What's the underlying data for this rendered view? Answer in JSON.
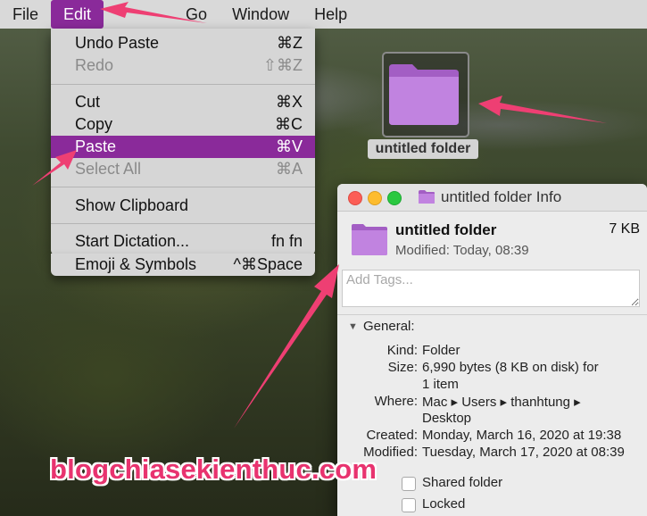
{
  "menubar": {
    "items": [
      "File",
      "Edit",
      "Go",
      "Window",
      "Help"
    ],
    "active": "Edit"
  },
  "edit_menu": {
    "items": [
      {
        "label": "Undo Paste",
        "shortcut": "⌘Z",
        "state": "enabled"
      },
      {
        "label": "Redo",
        "shortcut": "⇧⌘Z",
        "state": "disabled"
      },
      {
        "label": "Cut",
        "shortcut": "⌘X",
        "state": "enabled"
      },
      {
        "label": "Copy",
        "shortcut": "⌘C",
        "state": "enabled"
      },
      {
        "label": "Paste",
        "shortcut": "⌘V",
        "state": "highlighted"
      },
      {
        "label": "Select All",
        "shortcut": "⌘A",
        "state": "disabled"
      },
      {
        "label": "Show Clipboard",
        "shortcut": "",
        "state": "enabled"
      },
      {
        "label": "Start Dictation...",
        "shortcut": "fn fn",
        "state": "enabled"
      },
      {
        "label": "Emoji & Symbols",
        "shortcut": "^⌘Space",
        "state": "enabled"
      }
    ]
  },
  "desktop": {
    "folder_label": "untitled folder",
    "folder_icon": "folder-icon"
  },
  "info_window": {
    "title": "untitled folder Info",
    "name": "untitled folder",
    "size": "7 KB",
    "modified": "Modified: Today, 08:39",
    "tags_placeholder": "Add Tags...",
    "section": "General:",
    "fields": {
      "kind_key": "Kind:",
      "kind_val": "Folder",
      "size_key": "Size:",
      "size_val_1": "6,990 bytes (8 KB on disk) for",
      "size_val_2": "1 item",
      "where_key": "Where:",
      "where_val_1": "Mac ▸ Users ▸ thanhtung ▸",
      "where_val_2": "Desktop",
      "created_key": "Created:",
      "created_val": "Monday, March 16, 2020 at 19:38",
      "modified_key": "Modified:",
      "modified_val": "Tuesday, March 17, 2020 at 08:39"
    },
    "checkboxes": [
      "Shared folder",
      "Locked"
    ]
  },
  "colors": {
    "accent": "#8a2a9a",
    "folder": "#b574d6",
    "annotation": "#ee3f73"
  },
  "watermark": "blogchiasekienthuc.com"
}
